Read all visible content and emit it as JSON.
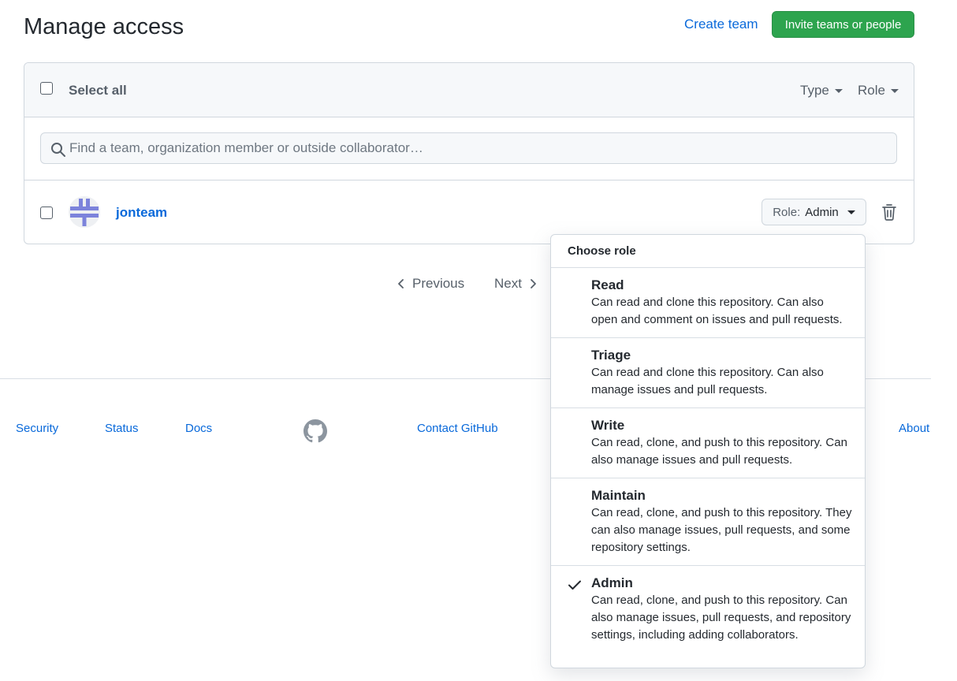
{
  "header": {
    "title": "Manage access",
    "create_team": "Create team",
    "invite": "Invite teams or people"
  },
  "list": {
    "select_all": "Select all",
    "type_filter": "Type",
    "role_filter": "Role",
    "search_placeholder": "Find a team, organization member or outside collaborator…",
    "members": [
      {
        "name": "jonteam",
        "role_prefix": "Role:",
        "role": "Admin"
      }
    ]
  },
  "pagination": {
    "previous": "Previous",
    "next": "Next"
  },
  "footer": {
    "links": [
      "Security",
      "Status",
      "Docs",
      "Contact GitHub",
      "About"
    ]
  },
  "role_menu": {
    "title": "Choose role",
    "selected": "Admin",
    "items": [
      {
        "name": "Read",
        "desc": "Can read and clone this repository. Can also open and comment on issues and pull requests."
      },
      {
        "name": "Triage",
        "desc": "Can read and clone this repository. Can also manage issues and pull requests."
      },
      {
        "name": "Write",
        "desc": "Can read, clone, and push to this repository. Can also manage issues and pull requests."
      },
      {
        "name": "Maintain",
        "desc": "Can read, clone, and push to this repository. They can also manage issues, pull requests, and some repository settings."
      },
      {
        "name": "Admin",
        "desc": "Can read, clone, and push to this repository. Can also manage issues, pull requests, and repository settings, including adding collaborators."
      }
    ]
  },
  "colors": {
    "link": "#0969da",
    "primary_button": "#2da44e",
    "border": "#d0d7de"
  }
}
